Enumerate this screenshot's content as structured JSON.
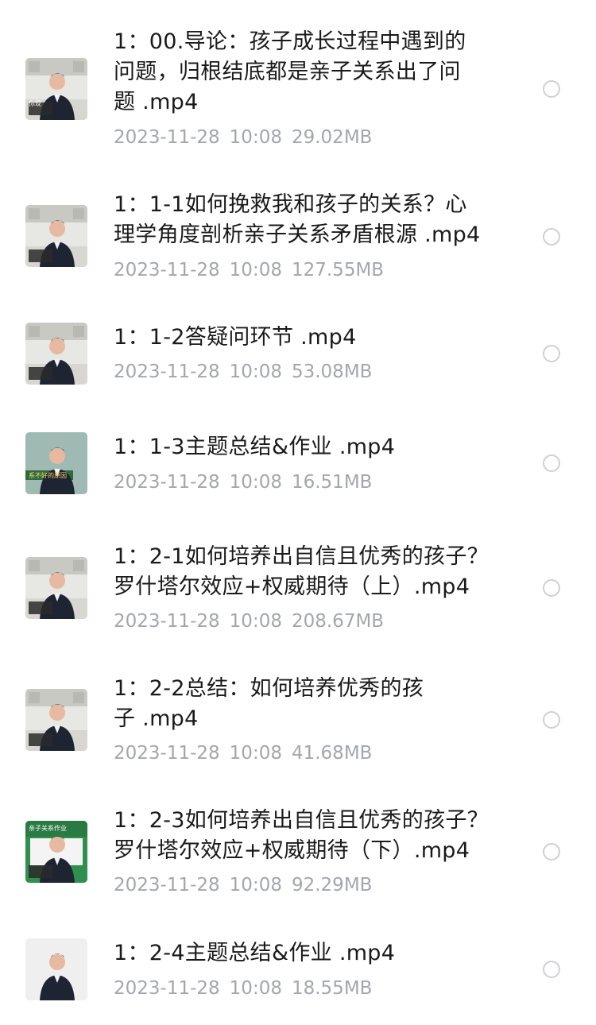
{
  "files": [
    {
      "title": "1：00.导论：孩子成长过程中遇到的\n问题，归根结底都是亲子关系出了问\n题 .mp4",
      "date": "2023-11-28",
      "time": "10:08",
      "size": "29.02MB",
      "caption": "你现",
      "style": "office"
    },
    {
      "title": "1：1-1如何挽救我和孩子的关系？心\n理学角度剖析亲子关系矛盾根源 .mp4",
      "date": "2023-11-28",
      "time": "10:08",
      "size": "127.55MB",
      "caption": "",
      "style": "office"
    },
    {
      "title": "1：1-2答疑问环节 .mp4",
      "date": "2023-11-28",
      "time": "10:08",
      "size": "53.08MB",
      "caption": "",
      "style": "office"
    },
    {
      "title": "1：1-3主题总结&作业 .mp4",
      "date": "2023-11-28",
      "time": "10:08",
      "size": "16.51MB",
      "caption": "系不好的原因",
      "style": "teal"
    },
    {
      "title": "1：2-1如何培养出自信且优秀的孩子？\n罗什塔尔效应+权威期待（上）.mp4",
      "date": "2023-11-28",
      "time": "10:08",
      "size": "208.67MB",
      "caption": "",
      "style": "office"
    },
    {
      "title": "1：2-2总结：如何培养优秀的孩\n子 .mp4",
      "date": "2023-11-28",
      "time": "10:08",
      "size": "41.68MB",
      "caption": "",
      "style": "office"
    },
    {
      "title": "1：2-3如何培养出自信且优秀的孩子？\n罗什塔尔效应+权威期待（下）.mp4",
      "date": "2023-11-28",
      "time": "10:08",
      "size": "92.29MB",
      "caption": "亲子关系作业",
      "style": "green"
    },
    {
      "title": "1：2-4主题总结&作业 .mp4",
      "date": "2023-11-28",
      "time": "10:08",
      "size": "18.55MB",
      "caption": "",
      "style": "plain"
    }
  ]
}
